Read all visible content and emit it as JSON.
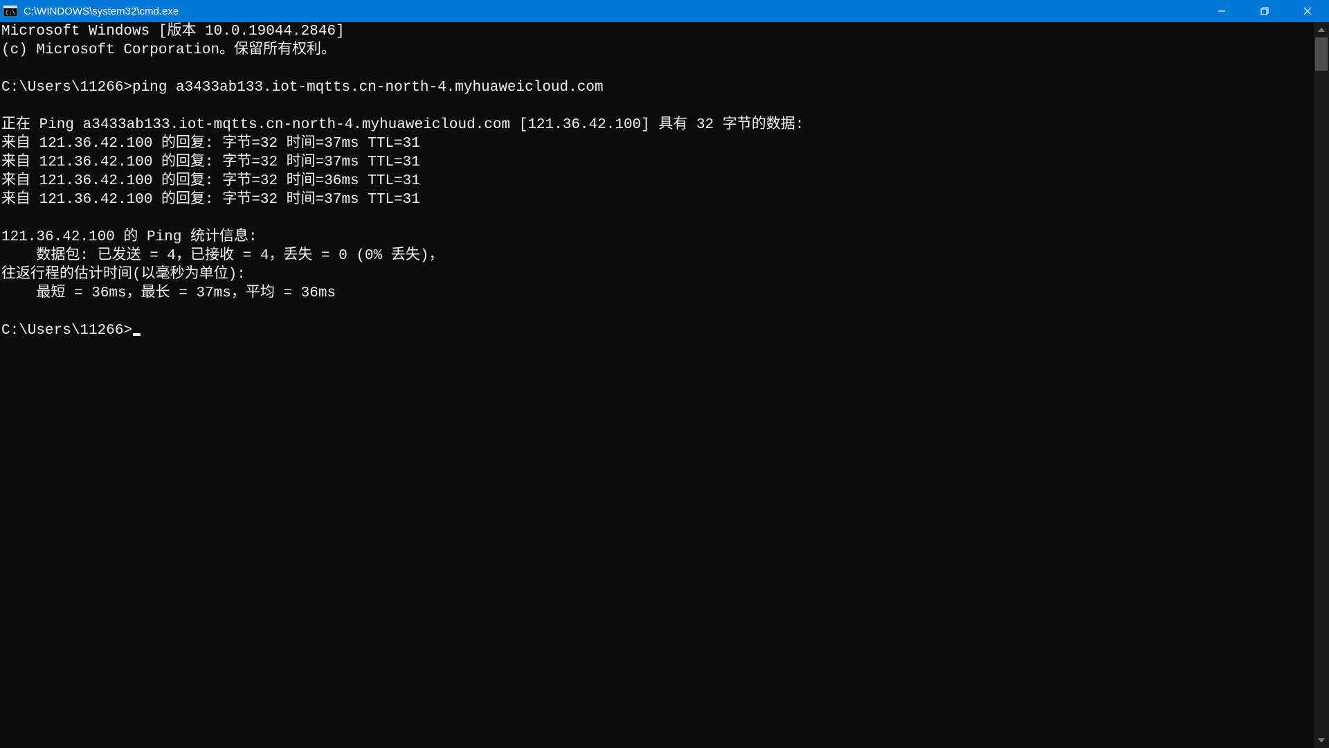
{
  "window": {
    "title": "C:\\WINDOWS\\system32\\cmd.exe"
  },
  "terminal": {
    "header1": "Microsoft Windows [版本 10.0.19044.2846]",
    "header2": "(c) Microsoft Corporation。保留所有权利。",
    "blank": "",
    "prompt1_path": "C:\\Users\\11266>",
    "prompt1_cmd": "ping a3433ab133.iot-mqtts.cn-north-4.myhuaweicloud.com",
    "ping_header": "正在 Ping a3433ab133.iot-mqtts.cn-north-4.myhuaweicloud.com [121.36.42.100] 具有 32 字节的数据:",
    "reply1": "来自 121.36.42.100 的回复: 字节=32 时间=37ms TTL=31",
    "reply2": "来自 121.36.42.100 的回复: 字节=32 时间=37ms TTL=31",
    "reply3": "来自 121.36.42.100 的回复: 字节=32 时间=36ms TTL=31",
    "reply4": "来自 121.36.42.100 的回复: 字节=32 时间=37ms TTL=31",
    "stats_header": "121.36.42.100 的 Ping 统计信息:",
    "stats_packets": "    数据包: 已发送 = 4，已接收 = 4，丢失 = 0 (0% 丢失)，",
    "stats_rtt_header": "往返行程的估计时间(以毫秒为单位):",
    "stats_rtt": "    最短 = 36ms，最长 = 37ms，平均 = 36ms",
    "prompt2_path": "C:\\Users\\11266>"
  }
}
